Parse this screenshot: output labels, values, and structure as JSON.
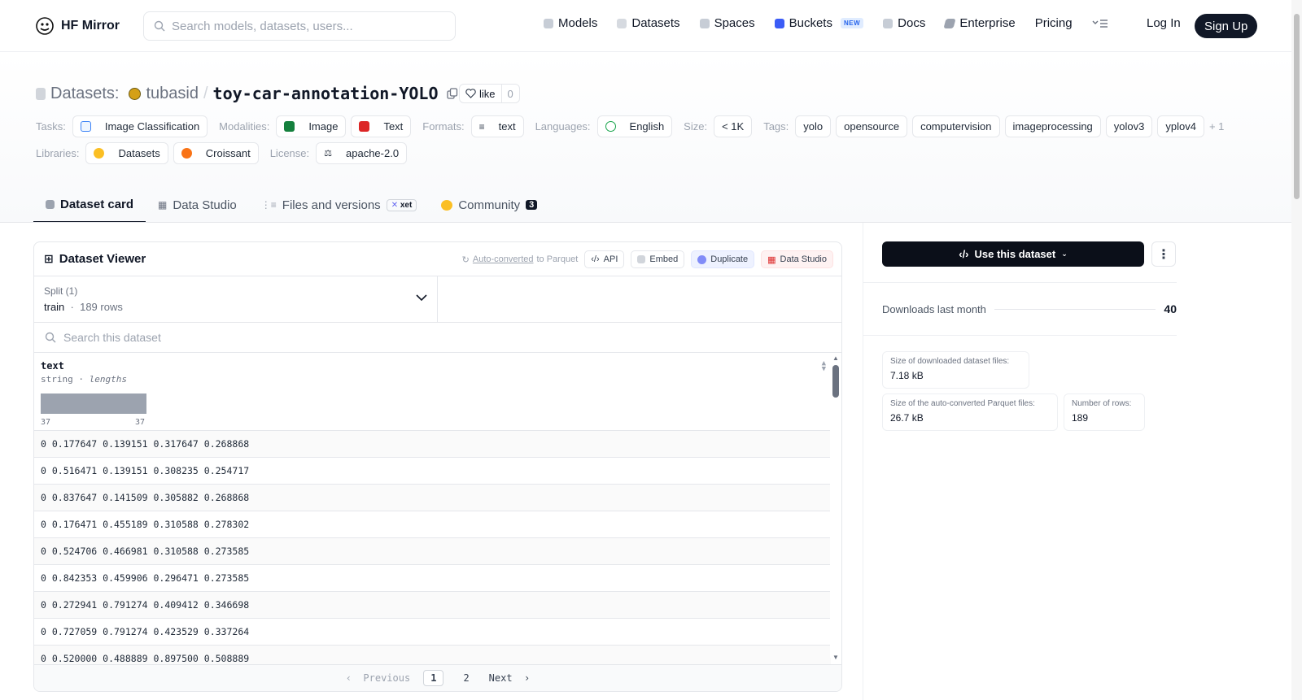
{
  "nav": {
    "brand": "HF Mirror",
    "search_placeholder": "Search models, datasets, users...",
    "links": [
      "Models",
      "Datasets",
      "Spaces",
      "Buckets",
      "Docs",
      "Enterprise",
      "Pricing"
    ],
    "new_badge": "NEW",
    "login": "Log In",
    "signup": "Sign Up"
  },
  "header": {
    "section_label": "Datasets:",
    "owner": "tubasid",
    "repo": "toy-car-annotation-YOLO",
    "like_label": "like",
    "like_count": "0"
  },
  "tags": {
    "tasks_label": "Tasks:",
    "tasks": [
      "Image Classification"
    ],
    "modalities_label": "Modalities:",
    "modalities": [
      "Image",
      "Text"
    ],
    "formats_label": "Formats:",
    "formats": [
      "text"
    ],
    "languages_label": "Languages:",
    "languages": [
      "English"
    ],
    "size_label": "Size:",
    "size": "< 1K",
    "tags_label": "Tags:",
    "tag_list": [
      "yolo",
      "opensource",
      "computervision",
      "imageprocessing",
      "yolov3",
      "yplov4"
    ],
    "more": "+ 1",
    "libraries_label": "Libraries:",
    "libraries": [
      "Datasets",
      "Croissant"
    ],
    "license_label": "License:",
    "license": "apache-2.0"
  },
  "tabs": {
    "card": "Dataset card",
    "studio": "Data Studio",
    "files": "Files and versions",
    "xet": "xet",
    "community": "Community",
    "community_count": "3"
  },
  "viewer": {
    "title": "Dataset Viewer",
    "auto_link": "Auto-converted",
    "auto_suffix": "to Parquet",
    "api": "API",
    "embed": "Embed",
    "duplicate": "Duplicate",
    "data_studio": "Data Studio",
    "split_label": "Split (1)",
    "split_name": "train",
    "split_rows": "189 rows",
    "search_placeholder": "Search this dataset",
    "column": {
      "name": "text",
      "type": "string",
      "stat": "lengths",
      "min": "37",
      "max": "37"
    },
    "rows": [
      "0 0.177647 0.139151 0.317647 0.268868",
      "0 0.516471 0.139151 0.308235 0.254717",
      "0 0.837647 0.141509 0.305882 0.268868",
      "0 0.176471 0.455189 0.310588 0.278302",
      "0 0.524706 0.466981 0.310588 0.273585",
      "0 0.842353 0.459906 0.296471 0.273585",
      "0 0.272941 0.791274 0.409412 0.346698",
      "0 0.727059 0.791274 0.423529 0.337264",
      "0 0.520000 0.488889 0.897500 0.508889"
    ],
    "pager": {
      "previous": "Previous",
      "pages": [
        "1",
        "2"
      ],
      "next": "Next"
    }
  },
  "sidebar": {
    "use_button": "Use this dataset",
    "downloads_label": "Downloads last month",
    "downloads_value": "40",
    "stats": [
      {
        "label": "Size of downloaded dataset files:",
        "value": "7.18 kB"
      },
      {
        "label": "Size of the auto-converted Parquet files:",
        "value": "26.7 kB"
      },
      {
        "label": "Number of rows:",
        "value": "189"
      }
    ]
  }
}
